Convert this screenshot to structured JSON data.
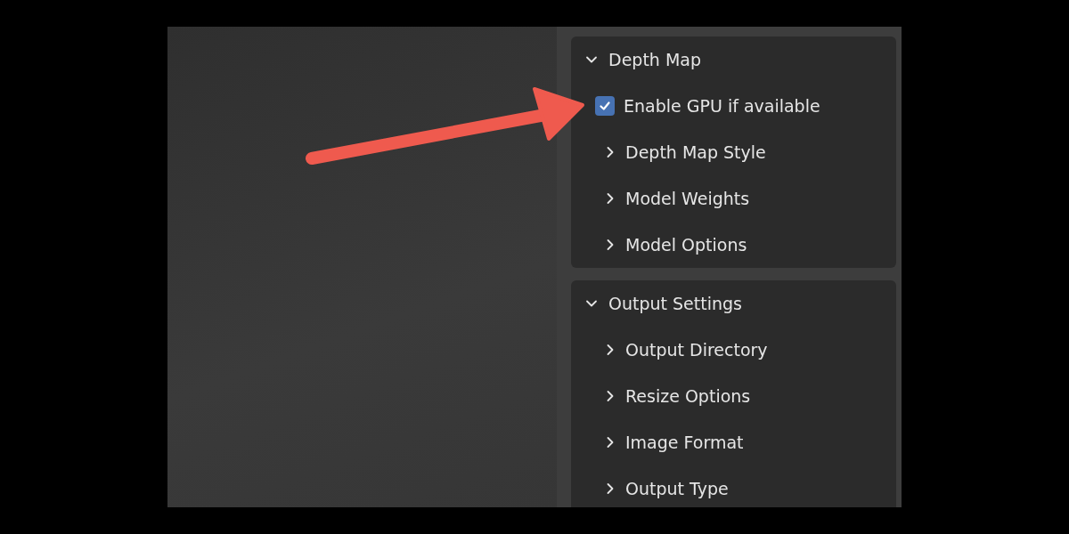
{
  "panels": [
    {
      "title": "Depth Map",
      "expanded": true,
      "items": [
        {
          "kind": "checkbox",
          "label": "Enable GPU if available",
          "checked": true
        },
        {
          "kind": "subpanel",
          "label": "Depth Map Style",
          "expanded": false
        },
        {
          "kind": "subpanel",
          "label": "Model Weights",
          "expanded": false
        },
        {
          "kind": "subpanel",
          "label": "Model Options",
          "expanded": false
        }
      ]
    },
    {
      "title": "Output Settings",
      "expanded": true,
      "items": [
        {
          "kind": "subpanel",
          "label": "Output Directory",
          "expanded": false
        },
        {
          "kind": "subpanel",
          "label": "Resize Options",
          "expanded": false
        },
        {
          "kind": "subpanel",
          "label": "Image Format",
          "expanded": false
        },
        {
          "kind": "subpanel",
          "label": "Output Type",
          "expanded": false
        }
      ]
    }
  ]
}
